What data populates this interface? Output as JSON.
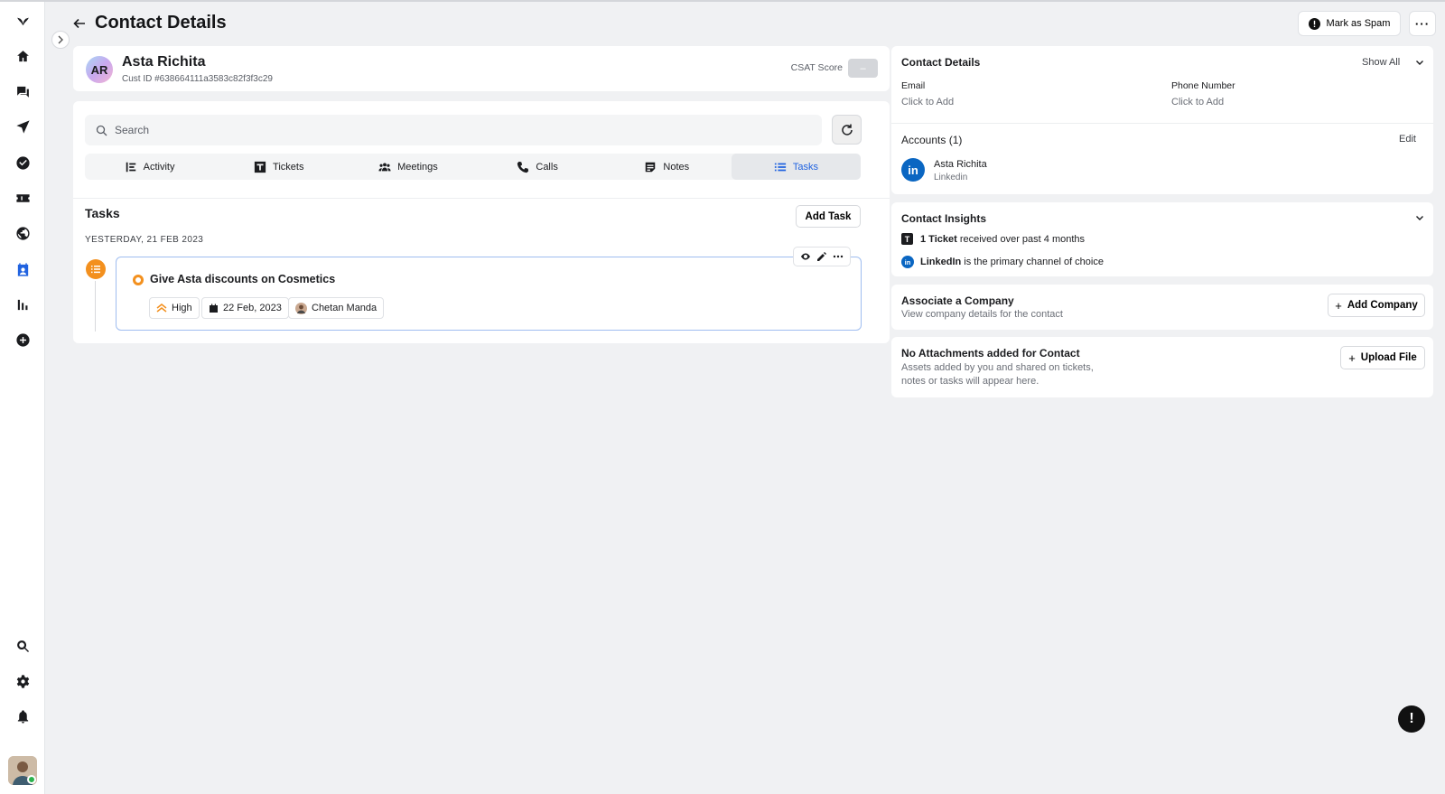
{
  "header": {
    "title": "Contact Details",
    "mark_spam_label": "Mark as Spam",
    "more_label": "···"
  },
  "profile": {
    "initials": "AR",
    "name": "Asta Richita",
    "cust_id": "Cust ID #638664111a3583c82f3f3c29",
    "csat_label": "CSAT Score",
    "csat_value": "–"
  },
  "activity": {
    "search_placeholder": "Search",
    "tabs": [
      {
        "label": "Activity",
        "icon": "activity-icon"
      },
      {
        "label": "Tickets",
        "icon": "ticket-icon"
      },
      {
        "label": "Meetings",
        "icon": "meetings-icon"
      },
      {
        "label": "Calls",
        "icon": "phone-icon"
      },
      {
        "label": "Notes",
        "icon": "notes-icon"
      },
      {
        "label": "Tasks",
        "icon": "tasks-icon",
        "active": true
      }
    ],
    "tasks_heading": "Tasks",
    "add_task_label": "Add Task",
    "date_heading": "YESTERDAY, 21 FEB 2023",
    "task": {
      "title": "Give Asta discounts on Cosmetics",
      "priority": "High",
      "due_date": "22 Feb, 2023",
      "assignee": "Chetan Manda"
    }
  },
  "contact_details": {
    "heading": "Contact Details",
    "show_all_label": "Show All",
    "email_label": "Email",
    "email_value": "Click to Add",
    "phone_label": "Phone Number",
    "phone_value": "Click to Add",
    "accounts_heading": "Accounts (1)",
    "edit_label": "Edit",
    "account_name": "Asta Richita",
    "account_channel": "Linkedin"
  },
  "insights": {
    "heading": "Contact Insights",
    "ticket_bold": "1 Ticket",
    "ticket_rest": " received over past 4 months",
    "channel_bold": "LinkedIn",
    "channel_rest": " is the primary channel of choice"
  },
  "company": {
    "heading": "Associate a Company",
    "sub": "View company details for the contact",
    "button_label": "Add Company"
  },
  "attachments": {
    "heading": "No Attachments added for Contact",
    "sub_line1": "Assets added by you and shared on tickets,",
    "sub_line2": "notes or tasks will appear here.",
    "button_label": "Upload File"
  },
  "colors": {
    "accent": "#2163e0",
    "task_orange": "#f3901e",
    "linkedin": "#0a66c2"
  }
}
